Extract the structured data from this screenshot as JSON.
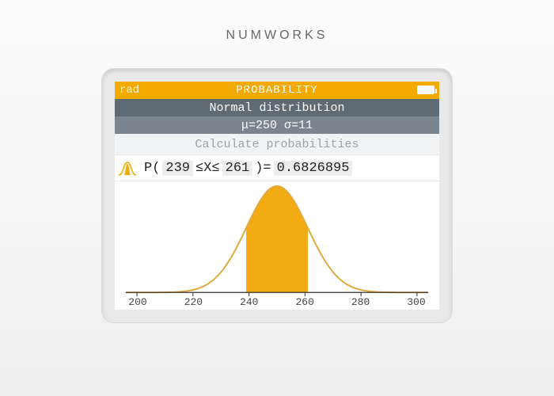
{
  "brand": "NUMWORKS",
  "status": {
    "rad": "rad",
    "title": "PROBABILITY"
  },
  "distribution": {
    "name": "Normal distribution",
    "params": "μ=250 σ=11"
  },
  "calc_label": "Calculate probabilities",
  "formula": {
    "open": "P(",
    "lower": "239",
    "rel": "≤X≤",
    "upper": "261",
    "close": ")=",
    "result": "0.6826895"
  },
  "chart_data": {
    "type": "area",
    "title": "Normal distribution",
    "xlabel": "",
    "ylabel": "",
    "mu": 250,
    "sigma": 11,
    "x_range": [
      196,
      304
    ],
    "shaded_interval": [
      239,
      261
    ],
    "x_ticks": [
      200,
      220,
      240,
      260,
      280,
      300
    ],
    "probability": 0.6826895
  },
  "colors": {
    "accent": "#f2a900",
    "curve": "#deaa3d",
    "fill": "#f2ab12"
  }
}
